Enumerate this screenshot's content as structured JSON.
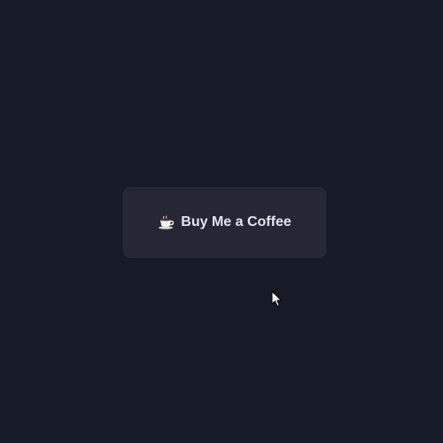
{
  "button": {
    "label": "Buy Me a Coffee",
    "icon": "coffee-cup-icon"
  },
  "colors": {
    "background": "#171b25",
    "button_bg": "#252834",
    "button_text": "#e4e5e9"
  },
  "cursor": {
    "icon": "mouse-pointer-icon"
  }
}
